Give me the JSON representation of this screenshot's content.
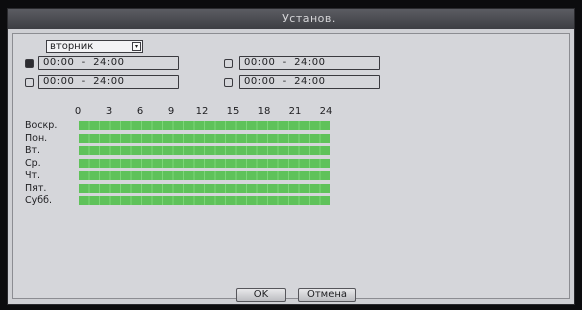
{
  "dialog": {
    "title": "Установ."
  },
  "day_select": {
    "value": "вторник",
    "arrow": "▾"
  },
  "periods": [
    {
      "enabled": true,
      "value": "00:00  -  24:00"
    },
    {
      "enabled": false,
      "value": "00:00  -  24:00"
    },
    {
      "enabled": false,
      "value": "00:00  -  24:00"
    },
    {
      "enabled": false,
      "value": "00:00  -  24:00"
    }
  ],
  "hours": [
    "0",
    "3",
    "6",
    "9",
    "12",
    "15",
    "18",
    "21",
    "24"
  ],
  "days": [
    "Воскр.",
    "Пон.",
    "Вт.",
    "Ср.",
    "Чт.",
    "Пят.",
    "Субб."
  ],
  "schedule_color": "#5fc25a",
  "buttons": {
    "ok": "OK",
    "cancel": "Отмена"
  }
}
